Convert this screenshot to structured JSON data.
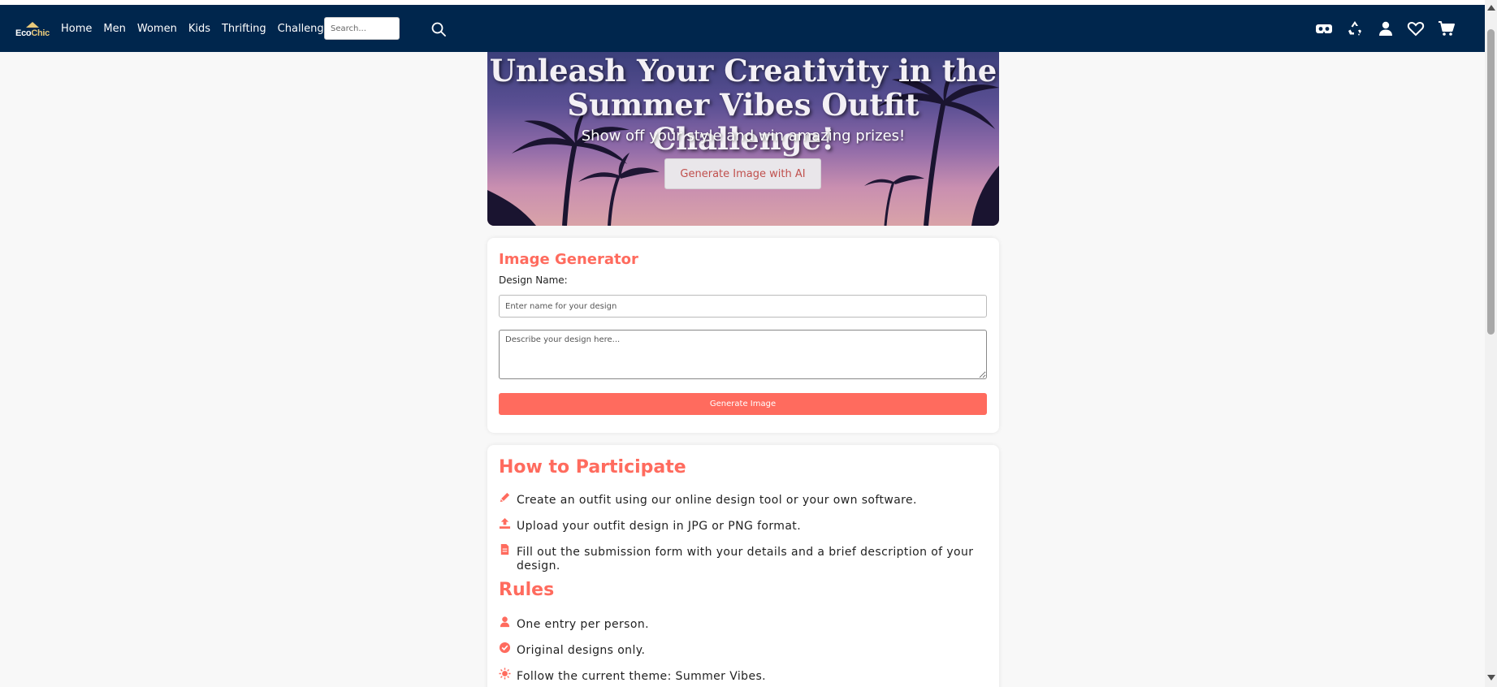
{
  "logo": {
    "text_a": "Eco",
    "text_b": "Chic"
  },
  "nav": {
    "links": [
      "Home",
      "Men",
      "Women",
      "Kids",
      "Thrifting",
      "Challenges"
    ],
    "search_placeholder": "Search..."
  },
  "icons": {
    "vr": "vr-headset-icon",
    "recycle": "recycle-icon",
    "user": "user-icon",
    "heart": "heart-icon",
    "cart": "cart-icon",
    "search": "search-icon"
  },
  "hero": {
    "title_line1": "Unleash Your Creativity in the",
    "title_line2": "Summer Vibes Outfit Challenge!",
    "subtitle": "Show off your style and win amazing prizes!",
    "button": "Generate Image with AI"
  },
  "generator": {
    "title": "Image Generator",
    "design_label": "Design Name:",
    "name_placeholder": "Enter name for your design",
    "desc_placeholder": "Describe your design here...",
    "button": "Generate Image"
  },
  "participate": {
    "title": "How to Participate",
    "steps": [
      {
        "icon": "pencil-icon",
        "text": "Create an outfit using our online design tool or your own software."
      },
      {
        "icon": "upload-icon",
        "text": "Upload your outfit design in JPG or PNG format."
      },
      {
        "icon": "document-icon",
        "text": "Fill out the submission form with your details and a brief description of your design."
      }
    ]
  },
  "rules": {
    "title": "Rules",
    "items": [
      {
        "icon": "person-icon",
        "text": "One entry per person."
      },
      {
        "icon": "check-circle-icon",
        "text": "Original designs only."
      },
      {
        "icon": "sun-icon",
        "text": "Follow the current theme: Summer Vibes."
      }
    ]
  },
  "colors": {
    "navbar": "#00264d",
    "accent": "#ff6b5e",
    "page_bg": "#f8f8f8"
  }
}
